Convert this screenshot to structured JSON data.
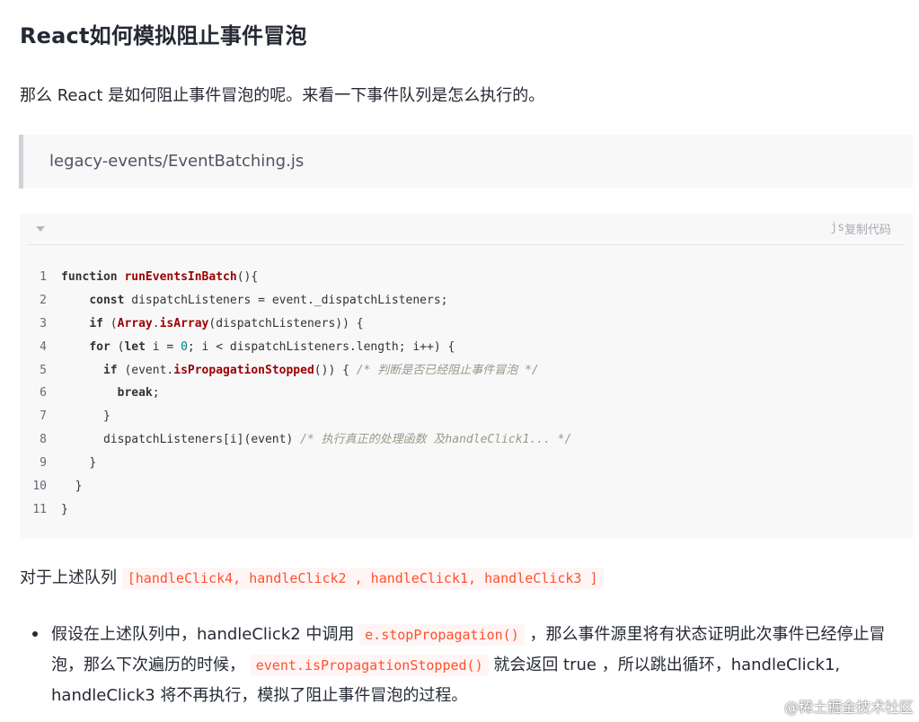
{
  "heading": "React如何模拟阻止事件冒泡",
  "intro": "那么 React 是如何阻止事件冒泡的呢。来看一下事件队列是怎么执行的。",
  "file_quote": "legacy-events/EventBatching.js",
  "code": {
    "lang": "js",
    "copy_label": "复制代码",
    "lines": {
      "n1": "1",
      "n2": "2",
      "n3": "3",
      "n4": "4",
      "n5": "5",
      "n6": "6",
      "n7": "7",
      "n8": "8",
      "n9": "9",
      "n10": "10",
      "n11": "11"
    },
    "t": {
      "function": "function",
      "runEventsInBatch": "runEventsInBatch",
      "paren_open_brace": "(){",
      "const": "const",
      "dispatch_assign": " dispatchListeners = event._dispatchListeners;",
      "if": "if",
      "paren": " (",
      "Array": "Array",
      "dot": ".",
      "isArray": "isArray",
      "isarray_rest": "(dispatchListeners)) {",
      "for": "for",
      "for_open": " (",
      "let": "let",
      "i_eq": " i = ",
      "zero": "0",
      "for_rest": "; i < dispatchListeners.length; i++) {",
      "event_open": " (event.",
      "isPropagationStopped": "isPropagationStopped",
      "stopped_rest": "()) { ",
      "comment1": "/* 判断是否已经阻止事件冒泡 */",
      "break": "break",
      "semicolon": ";",
      "close_brace": "}",
      "dispatch_call": "dispatchListeners[i](event) ",
      "comment2": "/* 执行真正的处理函数 及handleClick1... */"
    }
  },
  "para": {
    "prefix": "对于上述队列 ",
    "queue_code": "[handleClick4, handleClick2 , handleClick1, handleClick3 ]"
  },
  "bullet": {
    "part1": "假设在上述队列中，handleClick2 中调用 ",
    "code1": "e.stopPropagation()",
    "part2": " ，那么事件源里将有状态证明此次事件已经停止冒泡，那么下次遍历的时候， ",
    "code2": "event.isPropagationStopped()",
    "part3": " 就会返回 true ，所以跳出循环，handleClick1, handleClick3 将不再执行，模拟了阻止事件冒泡的过程。"
  },
  "watermark": "@稀土掘金技术社区"
}
